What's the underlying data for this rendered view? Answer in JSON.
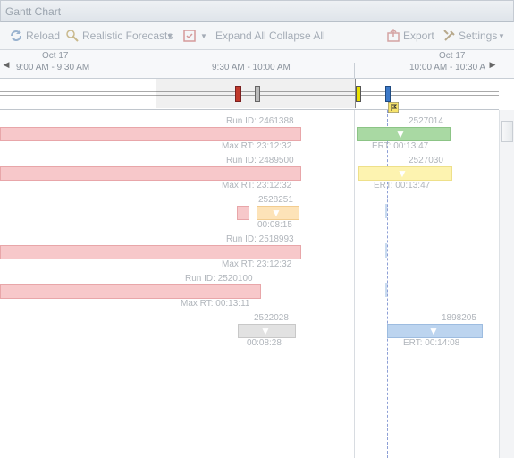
{
  "window": {
    "title": "Gantt Chart"
  },
  "toolbar": {
    "reload": "Reload",
    "forecasts": "Realistic Forecasts",
    "expand": "Expand All",
    "collapse": "Collapse All",
    "export": "Export",
    "settings": "Settings"
  },
  "timescale": {
    "dates": [
      "Oct 17",
      "Oct 17"
    ],
    "ranges": [
      "9:00 AM - 9:30 AM",
      "9:30 AM - 10:00 AM",
      "10:00 AM - 10:30 A"
    ]
  },
  "jobs": [
    {
      "id": "Run ID: 2461388",
      "rt": "Max RT: 23:12:32",
      "color": "#f7c8ca"
    },
    {
      "id": "2527014",
      "rt": "ERT: 00:13:47",
      "color": "#a9d9a3"
    },
    {
      "id": "Run ID: 2489500",
      "rt": "Max RT: 23:12:32",
      "color": "#f7c8ca"
    },
    {
      "id": "2527030",
      "rt": "ERT: 00:13:47",
      "color": "#fdf3b0"
    },
    {
      "id": "2528251",
      "rt": "00:08:15",
      "color": "#fde3b8"
    },
    {
      "id": "Run ID: 2518993",
      "rt": "Max RT: 23:12:32",
      "color": "#f7c8ca"
    },
    {
      "id": "Run ID: 2520100",
      "rt": "Max RT: 00:13:11",
      "color": "#f7c8ca"
    },
    {
      "id": "2522028",
      "rt": "00:08:28",
      "color": "#e2e2e2"
    },
    {
      "id": "1898205",
      "rt": "ERT: 00:14:08",
      "color": "#bcd4ef"
    }
  ]
}
